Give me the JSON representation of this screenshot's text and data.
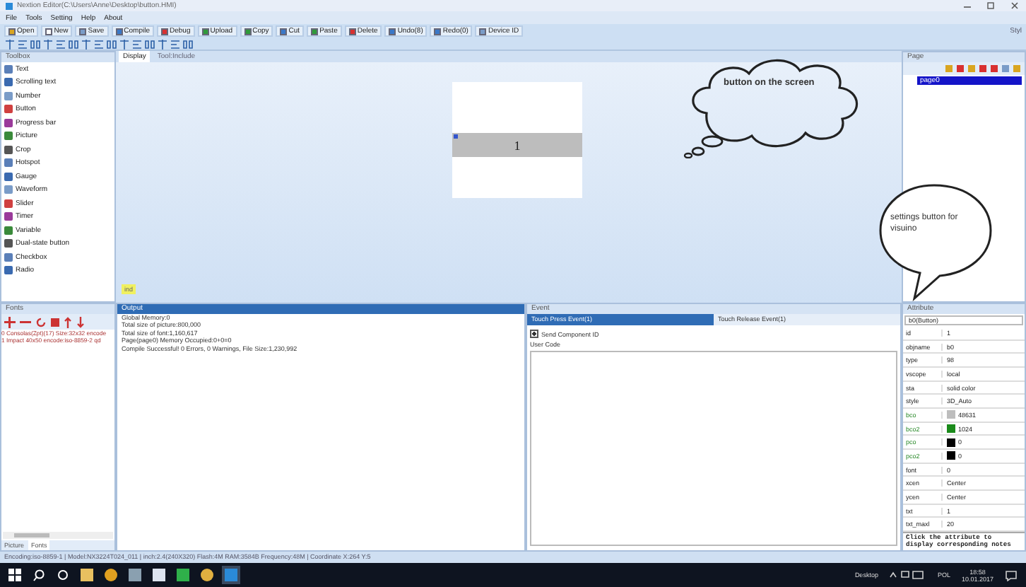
{
  "window": {
    "title": "Nextion Editor(C:\\Users\\Anne\\Desktop\\button.HMI)"
  },
  "menu": [
    "File",
    "Tools",
    "Setting",
    "Help",
    "About"
  ],
  "toolbar": [
    "Open",
    "New",
    "Save",
    "Compile",
    "Debug",
    "Upload",
    "Copy",
    "Cut",
    "Paste",
    "Delete",
    "Undo(8)",
    "Redo(0)",
    "Device ID"
  ],
  "style_label": "Styl",
  "toolbox": {
    "title": "Toolbox",
    "items": [
      "Text",
      "Scrolling text",
      "Number",
      "Button",
      "Progress bar",
      "Picture",
      "Crop",
      "Hotspot",
      "Gauge",
      "Waveform",
      "Slider",
      "Timer",
      "Variable",
      "Dual-state button",
      "Checkbox",
      "Radio"
    ]
  },
  "display_tabs": [
    {
      "label": "Display",
      "selected": true
    },
    {
      "label": "Tool:Include",
      "selected": false
    }
  ],
  "canvas": {
    "button_text": "1"
  },
  "hidden_component": "ind",
  "callouts": [
    {
      "text": "button on the screen"
    },
    {
      "text": "settings button for visuino"
    }
  ],
  "page_panel": {
    "title": "Page",
    "pages": [
      {
        "label": "page0",
        "selected": true
      }
    ]
  },
  "fonts_panel": {
    "title": "Fonts",
    "rows": [
      "0 Consolas(Zpt)(17) Size:32x32 encode",
      "1 Impact 40x50 encode:iso-8859-2 qd"
    ],
    "tabs": [
      {
        "label": "Picture",
        "selected": false
      },
      {
        "label": "Fonts",
        "selected": true
      }
    ]
  },
  "output": {
    "title": "Output",
    "lines": [
      "Global Memory:0",
      "Total size of picture:800,000",
      "Total size of font:1,160,617",
      "Page(page0) Memory Occupied:0+0=0",
      "Compile Successful! 0 Errors, 0 Warnings, File Size:1,230,992"
    ]
  },
  "event": {
    "title": "Event",
    "tabs": [
      {
        "label": "Touch Press Event(1)",
        "selected": true
      },
      {
        "label": "Touch Release Event(1)",
        "selected": false
      }
    ],
    "send_id": {
      "label": "Send Component ID",
      "checked": true
    },
    "user_code_label": "User Code"
  },
  "attributes": {
    "title": "Attribute",
    "component": "b0(Button)",
    "rows": [
      {
        "name": "id",
        "value": "1"
      },
      {
        "name": "objname",
        "value": "b0"
      },
      {
        "name": "type",
        "value": "98"
      },
      {
        "name": "vscope",
        "value": "local"
      },
      {
        "name": "sta",
        "value": "solid color"
      },
      {
        "name": "style",
        "value": "3D_Auto"
      },
      {
        "name": "bco",
        "value": "48631",
        "color": "#bdbdbd"
      },
      {
        "name": "bco2",
        "value": "1024",
        "color": "#1a8a1a"
      },
      {
        "name": "pco",
        "value": "0",
        "color": "#000000"
      },
      {
        "name": "pco2",
        "value": "0",
        "color": "#000000"
      },
      {
        "name": "font",
        "value": "0"
      },
      {
        "name": "xcen",
        "value": "Center"
      },
      {
        "name": "ycen",
        "value": "Center"
      },
      {
        "name": "txt",
        "value": "1"
      },
      {
        "name": "txt_maxl",
        "value": "20"
      }
    ],
    "note": "Click the attribute to display corresponding notes"
  },
  "status_bar": "Encoding:iso-8859-1 | Model:NX3224T024_011 | inch:2.4(240X320) Flash:4M RAM:3584B Frequency:48M | Coordinate X:264 Y:5",
  "taskbar": {
    "desktop_label": "Desktop",
    "lang": "POL",
    "time": "18:58",
    "date": "10.01.2017"
  }
}
